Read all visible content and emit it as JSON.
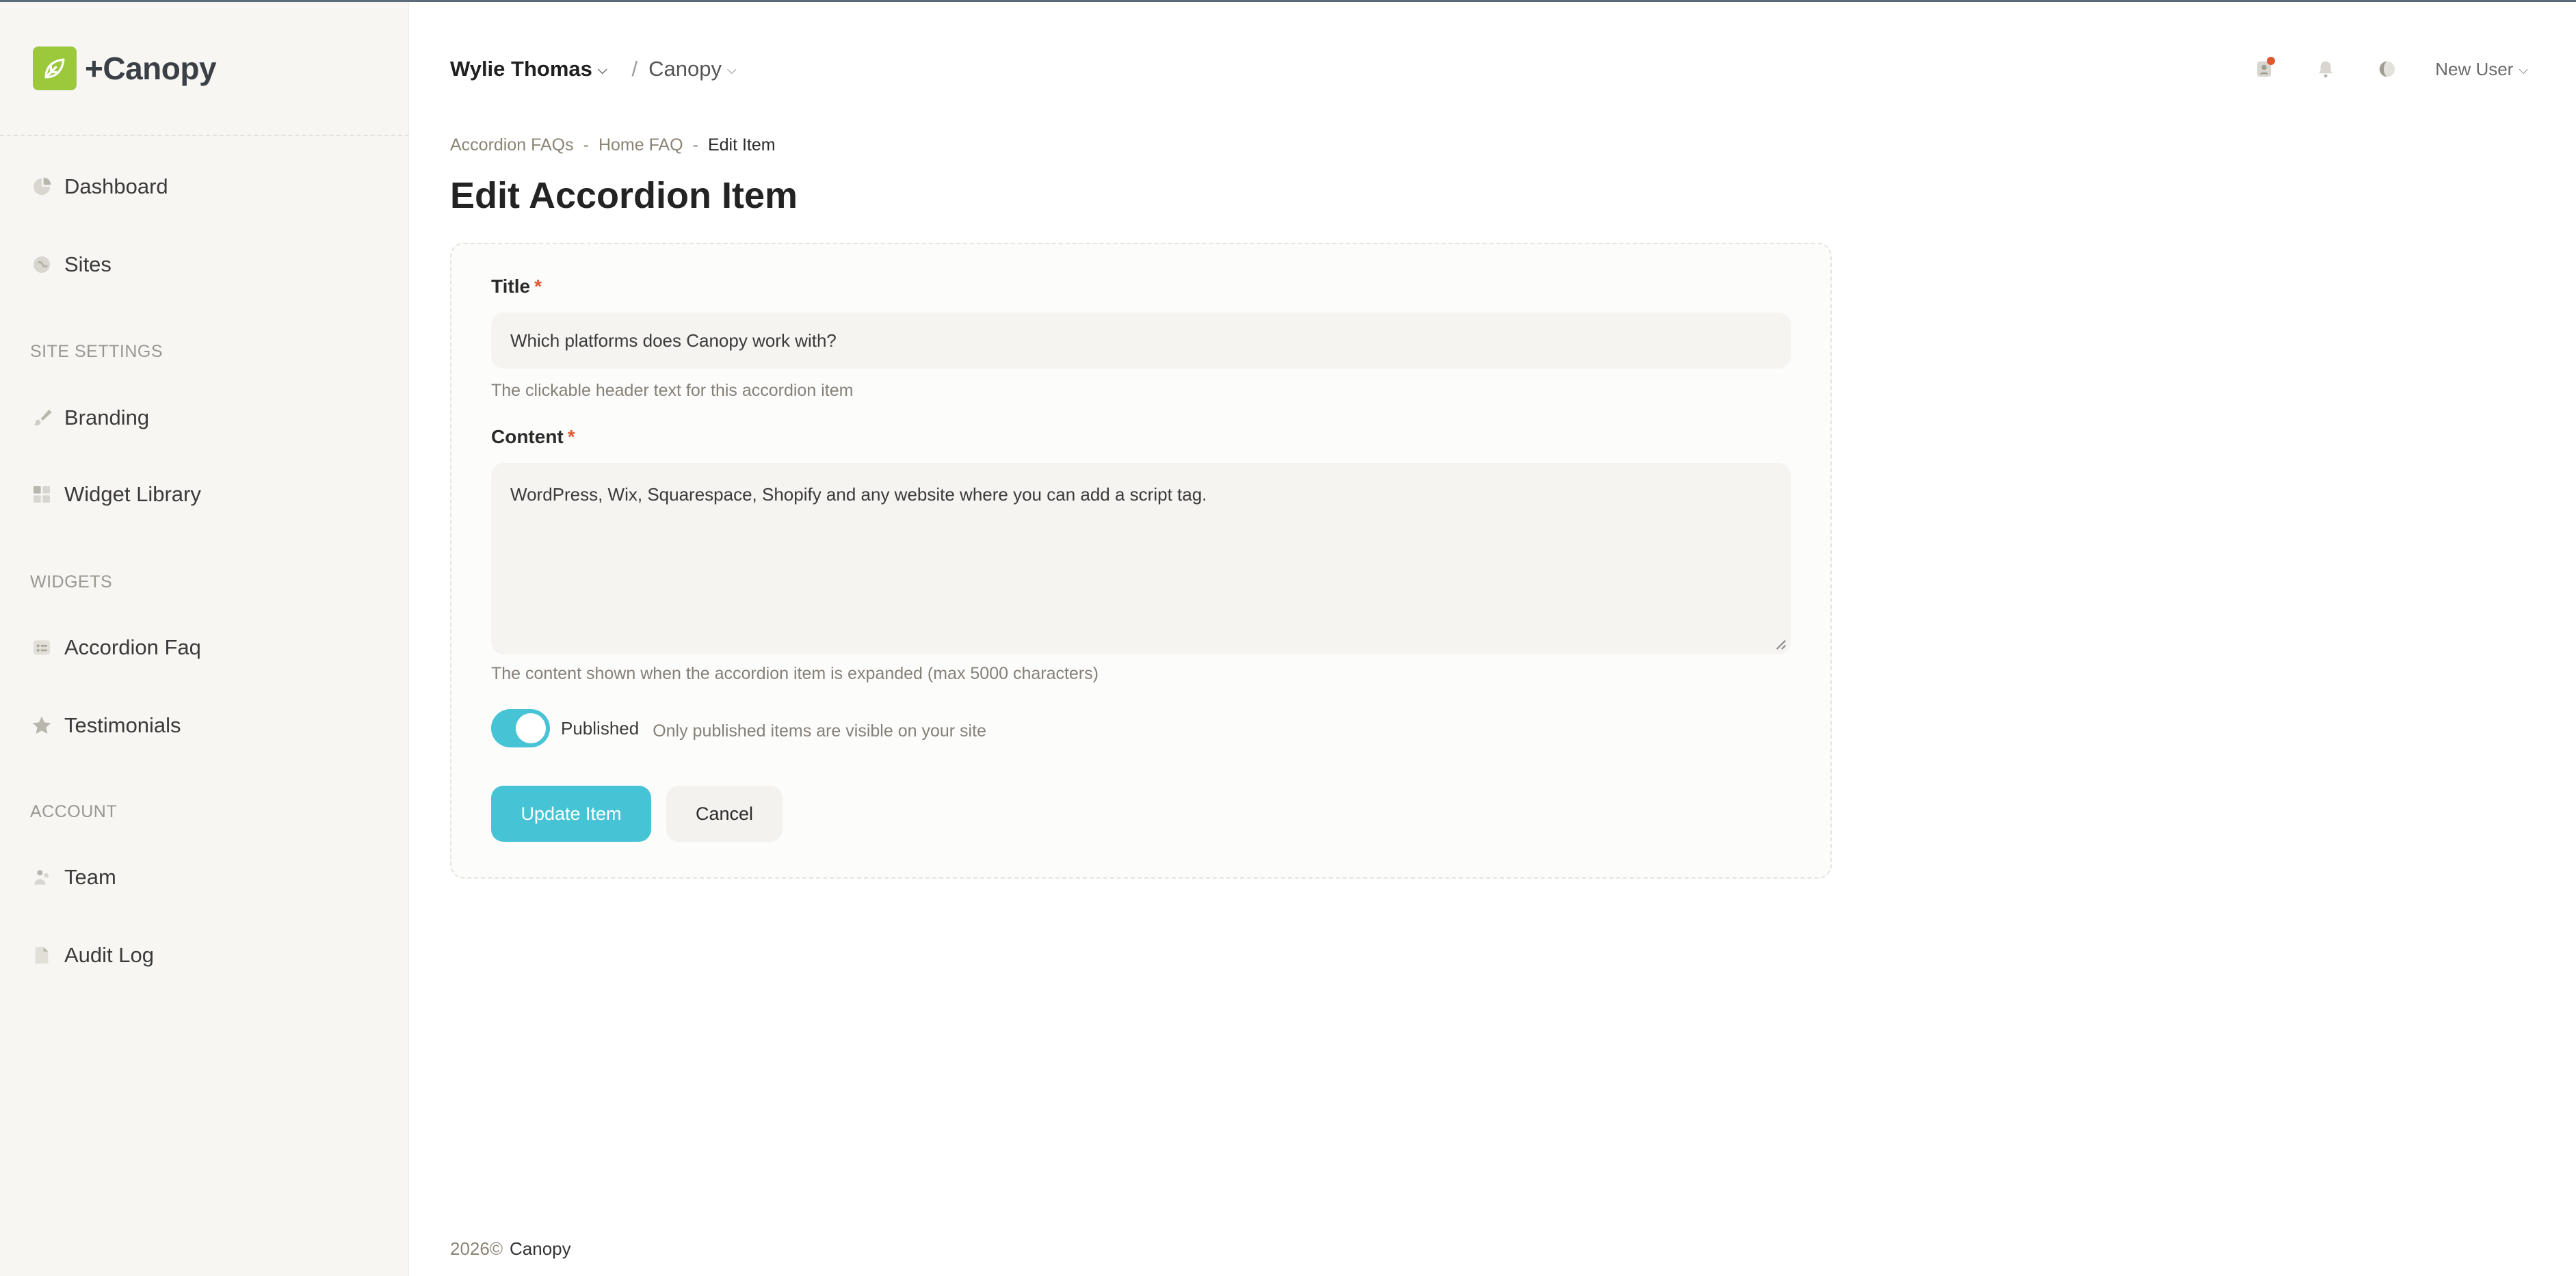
{
  "app": {
    "name": "+Canopy"
  },
  "header": {
    "org": "Wylie Thomas",
    "site": "Canopy",
    "separator": "/",
    "user": "New User"
  },
  "sidebar": {
    "items": [
      {
        "label": "Dashboard",
        "icon": "pie-chart-icon"
      },
      {
        "label": "Sites",
        "icon": "globe-icon"
      }
    ],
    "sections": [
      {
        "title": "SITE SETTINGS",
        "items": [
          {
            "label": "Branding",
            "icon": "brush-icon"
          },
          {
            "label": "Widget Library",
            "icon": "grid-icon"
          }
        ]
      },
      {
        "title": "WIDGETS",
        "items": [
          {
            "label": "Accordion Faq",
            "icon": "list-icon"
          },
          {
            "label": "Testimonials",
            "icon": "star-icon"
          }
        ]
      },
      {
        "title": "ACCOUNT",
        "items": [
          {
            "label": "Team",
            "icon": "team-icon"
          },
          {
            "label": "Audit Log",
            "icon": "document-icon"
          }
        ]
      }
    ]
  },
  "breadcrumb": {
    "items": [
      "Accordion FAQs",
      "Home FAQ",
      "Edit Item"
    ],
    "separator": "-"
  },
  "page": {
    "title": "Edit Accordion Item"
  },
  "form": {
    "title_label": "Title",
    "required_mark": "*",
    "title_value": "Which platforms does Canopy work with?",
    "title_help": "The clickable header text for this accordion item",
    "content_label": "Content",
    "content_value": "WordPress, Wix, Squarespace, Shopify and any website where you can add a script tag.",
    "content_help": "The content shown when the accordion item is expanded (max 5000 characters)",
    "published_label": "Published",
    "published_checked": true,
    "published_help": "Only published items are visible on your site",
    "update_label": "Update Item",
    "cancel_label": "Cancel"
  },
  "footer": {
    "year": "2026©",
    "brand": "Canopy"
  },
  "colors": {
    "accent": "#46c4d6",
    "brand": "#9bc93b",
    "required": "#e0582f",
    "sidebar_bg": "#f7f6f2"
  }
}
